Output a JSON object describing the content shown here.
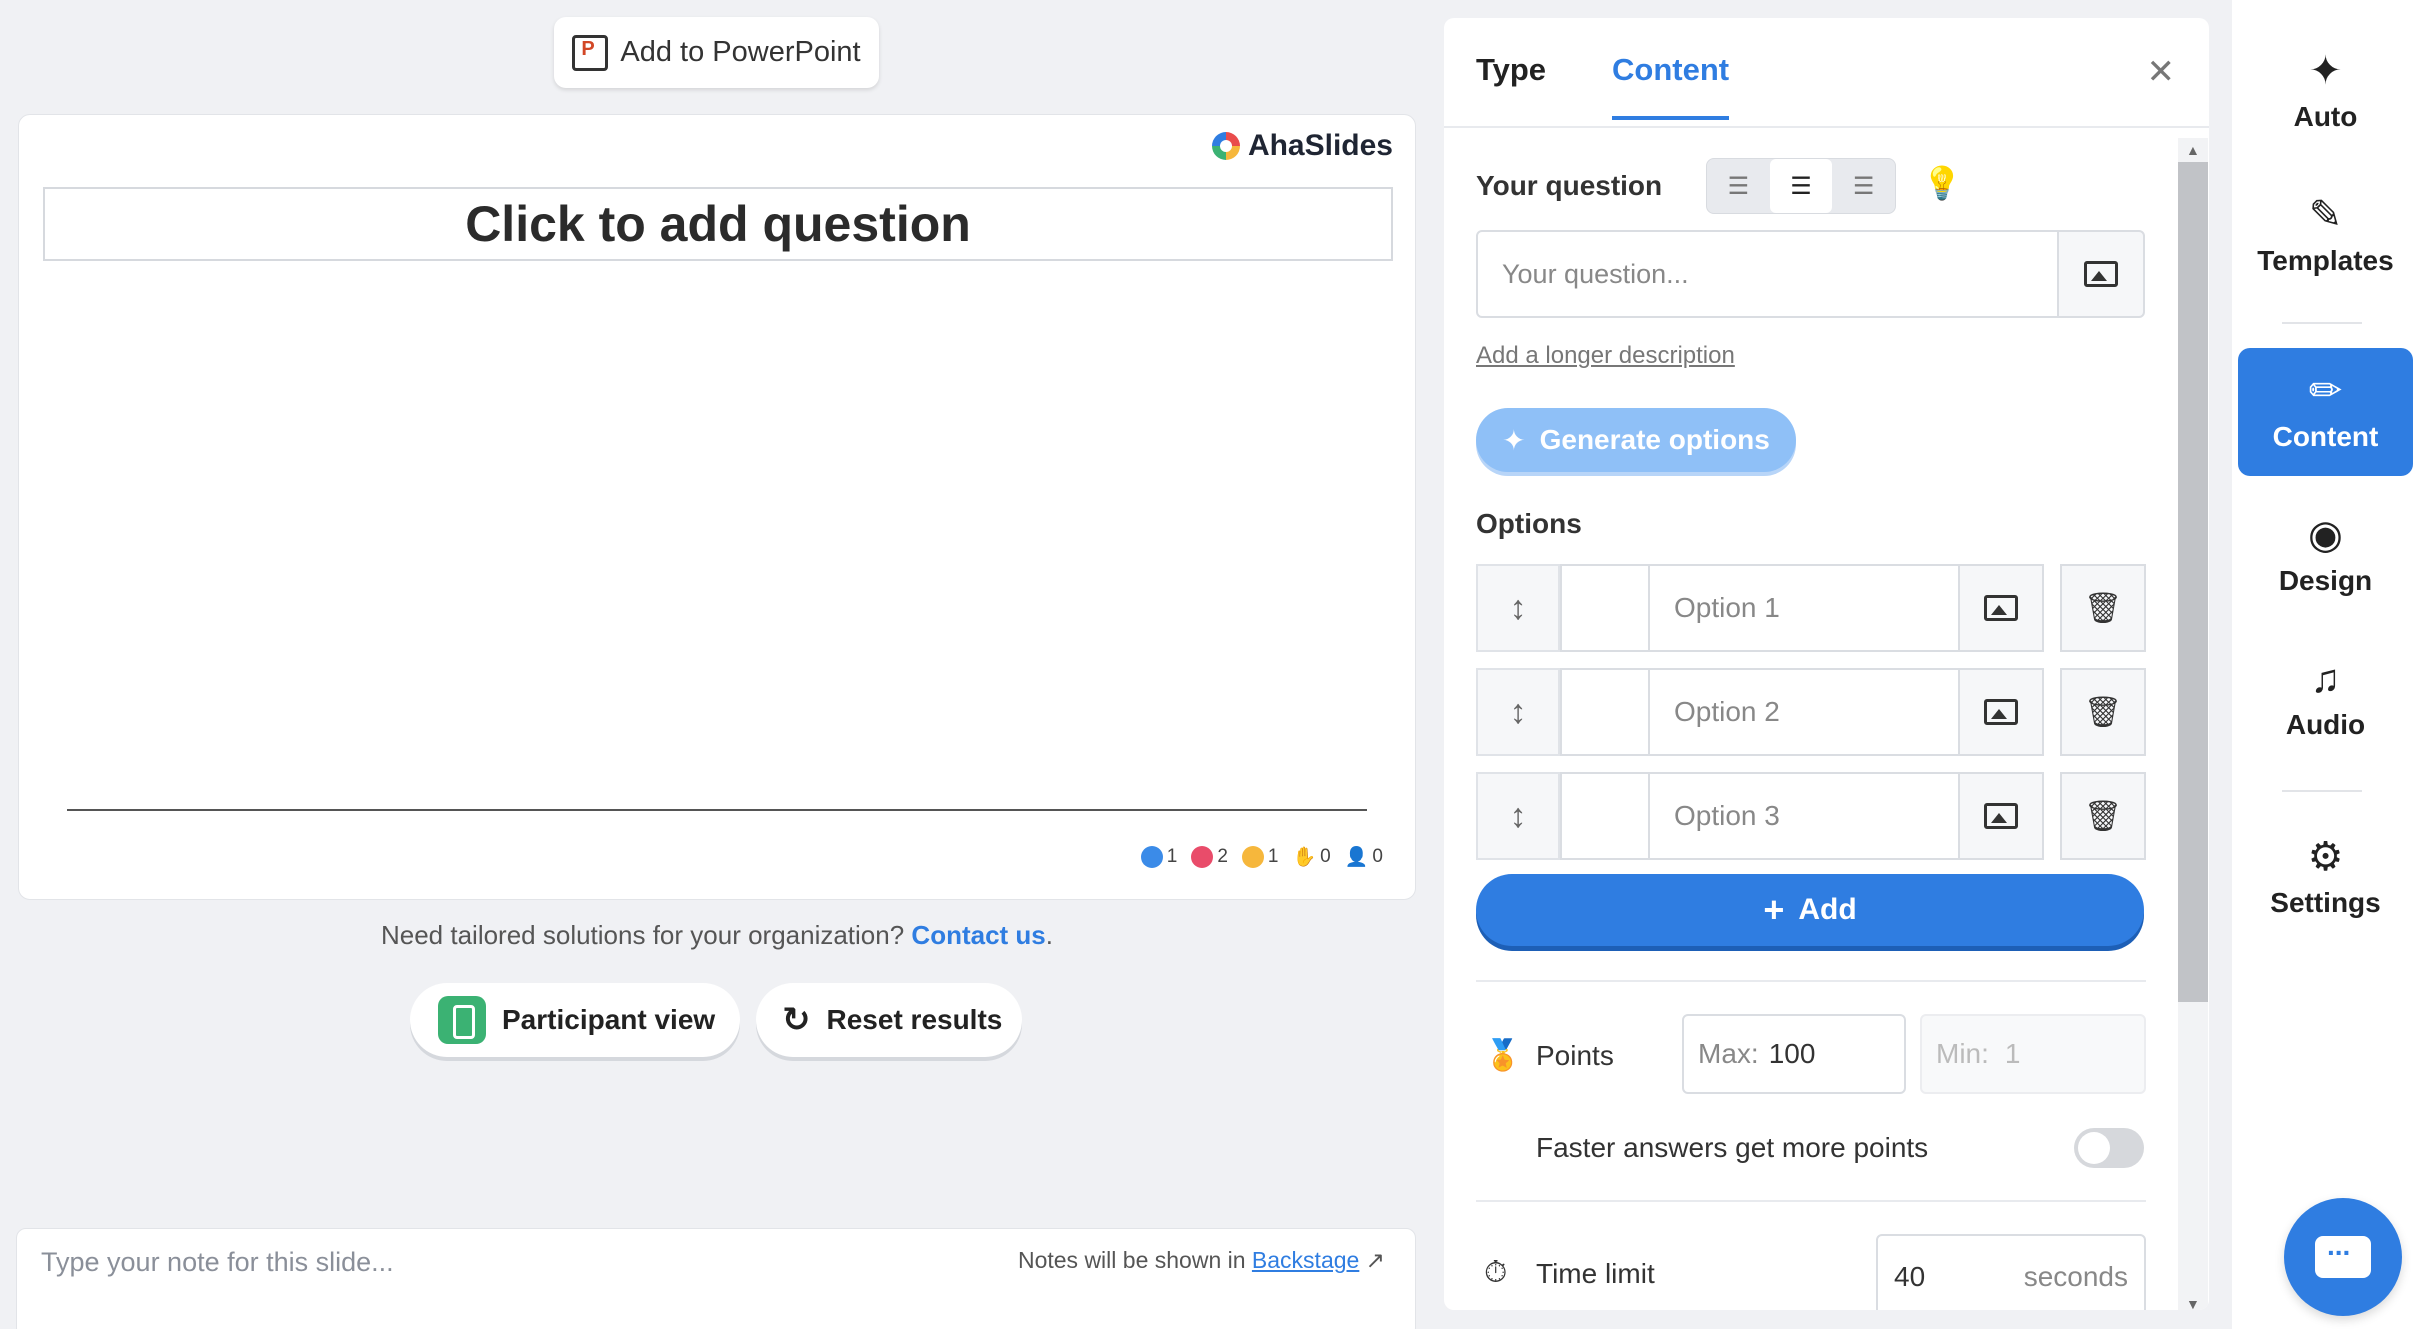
{
  "toolbar": {
    "add_to_ppt": "Add to PowerPoint"
  },
  "slide": {
    "brand": "AhaSlides",
    "question_title": "Click to add question",
    "reactions": [
      {
        "icon": "thumbs-up-icon",
        "count": "1",
        "color": "#3b8be8"
      },
      {
        "icon": "heart-icon",
        "count": "2",
        "color": "#e94c6a"
      },
      {
        "icon": "sad-face-icon",
        "count": "1",
        "color": "#f6b73c"
      },
      {
        "icon": "hand-icon",
        "count": "0",
        "color": "#333333"
      },
      {
        "icon": "user-icon",
        "count": "0",
        "color": "#333333"
      }
    ]
  },
  "contact": {
    "text": "Need tailored solutions for your organization?",
    "link": "Contact us",
    "suffix": "."
  },
  "actions": {
    "participant_view": "Participant view",
    "reset_results": "Reset results"
  },
  "notes": {
    "placeholder": "Type your note for this slide...",
    "hint": "Notes will be shown in",
    "hint_link": "Backstage"
  },
  "panel": {
    "tabs": {
      "type": "Type",
      "content": "Content"
    },
    "close": "✕",
    "question_label": "Your question",
    "question_placeholder": "Your question...",
    "longer_description": "Add a longer description",
    "generate_options": "Generate options",
    "options_label": "Options",
    "options": [
      {
        "placeholder": "Option 1"
      },
      {
        "placeholder": "Option 2"
      },
      {
        "placeholder": "Option 3"
      }
    ],
    "add": "Add",
    "points": {
      "label": "Points",
      "max_prefix": "Max:",
      "max": "100",
      "min_prefix": "Min:",
      "min": "1"
    },
    "faster_answers": "Faster answers get more points",
    "faster_answers_enabled": false,
    "time_limit": {
      "label": "Time limit",
      "value": "40",
      "unit": "seconds"
    }
  },
  "nav": {
    "items": [
      {
        "label": "Auto",
        "icon": "sparkles-icon"
      },
      {
        "label": "Templates",
        "icon": "magic-wand-icon"
      },
      {
        "label": "Content",
        "icon": "pencil-icon",
        "active": true
      },
      {
        "label": "Design",
        "icon": "palette-icon"
      },
      {
        "label": "Audio",
        "icon": "music-note-icon"
      },
      {
        "label": "Settings",
        "icon": "gear-icon"
      }
    ]
  },
  "colors": {
    "accent": "#2f7de1",
    "generate_button": "#8fc0f7",
    "participant_green": "#3bb273"
  }
}
